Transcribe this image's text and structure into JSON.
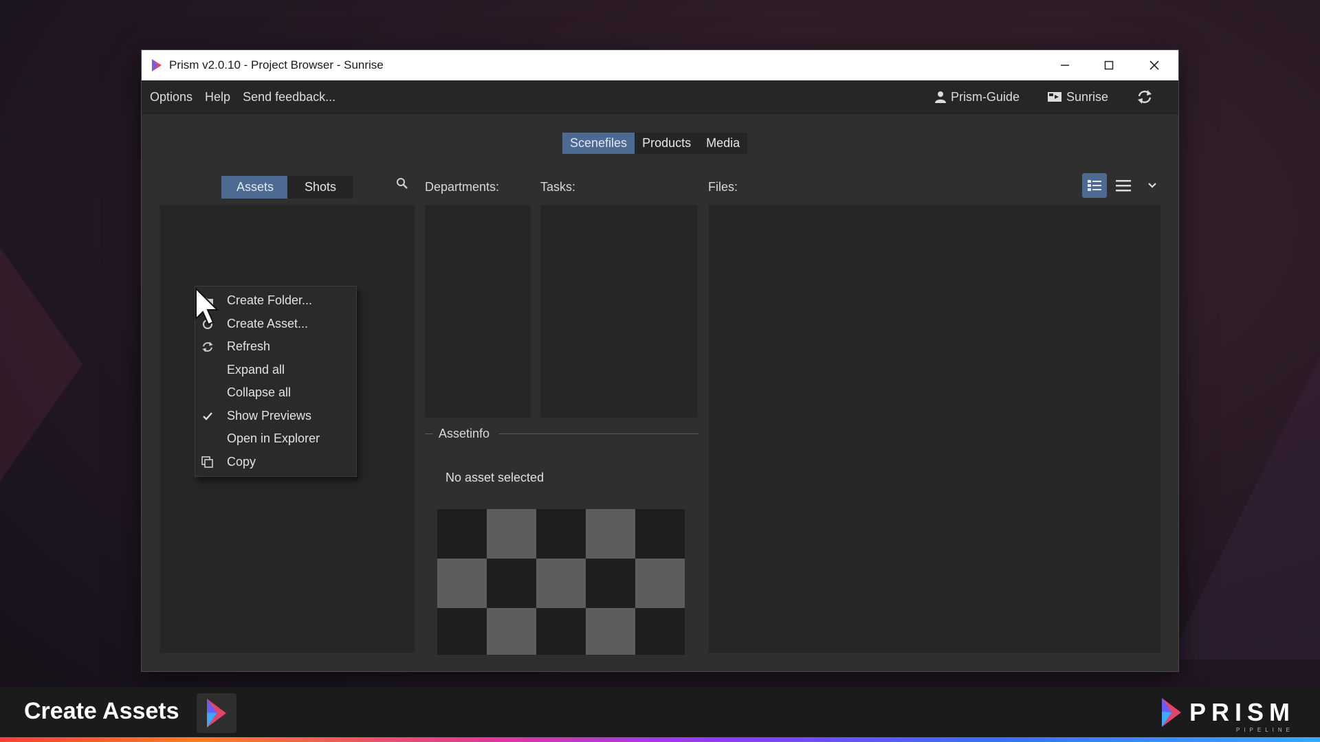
{
  "window": {
    "title": "Prism v2.0.10 - Project Browser - Sunrise"
  },
  "menubar": {
    "items": [
      "Options",
      "Help",
      "Send feedback..."
    ],
    "user_label": "Prism-Guide",
    "project_label": "Sunrise"
  },
  "top_tabs": [
    {
      "label": "Scenefiles",
      "active": true
    },
    {
      "label": "Products",
      "active": false
    },
    {
      "label": "Media",
      "active": false
    }
  ],
  "sub_tabs": [
    {
      "label": "Assets",
      "active": true
    },
    {
      "label": "Shots",
      "active": false
    }
  ],
  "columns": {
    "departments": "Departments:",
    "tasks": "Tasks:",
    "files": "Files:"
  },
  "assetinfo": {
    "legend": "Assetinfo",
    "empty_text": "No asset selected"
  },
  "context_menu": {
    "items": [
      {
        "label": "Create Folder...",
        "icon": "folder-icon"
      },
      {
        "label": "Create Asset...",
        "icon": "asset-icon"
      },
      {
        "label": "Refresh",
        "icon": "refresh-icon"
      },
      {
        "label": "Expand all",
        "icon": ""
      },
      {
        "label": "Collapse all",
        "icon": ""
      },
      {
        "label": "Show Previews",
        "icon": "check-icon",
        "checked": true
      },
      {
        "label": "Open in Explorer",
        "icon": ""
      },
      {
        "label": "Copy",
        "icon": "copy-icon"
      }
    ]
  },
  "footer": {
    "title": "Create Assets",
    "brand": "PRISM",
    "brand_sub": "PIPELINE"
  },
  "colors": {
    "accent": "#4d6a93",
    "window_bg": "#2f2f2f",
    "panel_bg": "#262626"
  }
}
